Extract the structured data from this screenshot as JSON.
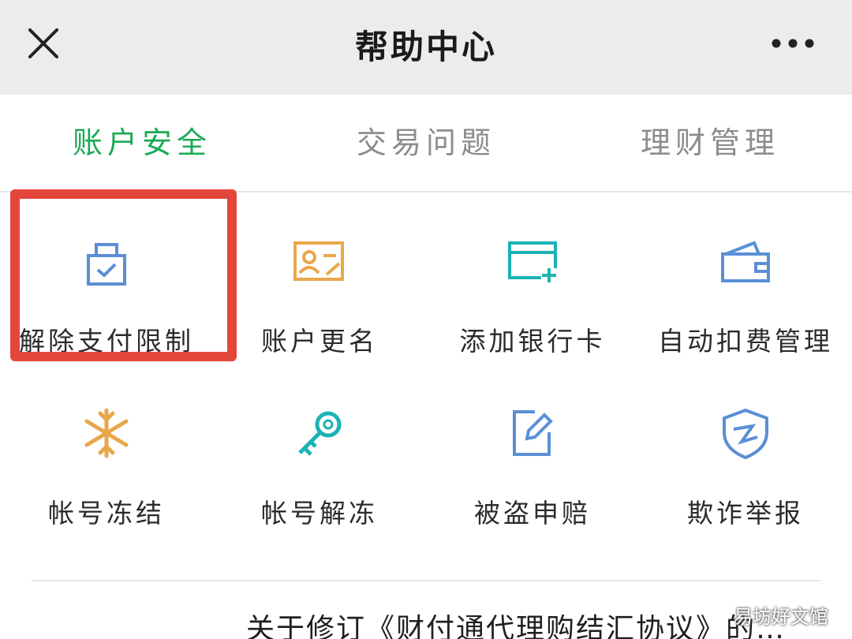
{
  "nav": {
    "title": "帮助中心",
    "close_icon": "close-icon",
    "more_icon": "more-icon"
  },
  "tabs": [
    {
      "label": "账户安全",
      "active": true
    },
    {
      "label": "交易问题",
      "active": false
    },
    {
      "label": "理财管理",
      "active": false
    }
  ],
  "grid": {
    "items": [
      {
        "label": "解除支付限制",
        "icon": "lock-check-icon",
        "color": "#5b8fd6"
      },
      {
        "label": "账户更名",
        "icon": "id-card-icon",
        "color": "#e9a74b"
      },
      {
        "label": "添加银行卡",
        "icon": "add-card-icon",
        "color": "#1bb3b3"
      },
      {
        "label": "自动扣费管理",
        "icon": "wallet-icon",
        "color": "#5b8fd6"
      },
      {
        "label": "帐号冻结",
        "icon": "snowflake-icon",
        "color": "#e9a74b"
      },
      {
        "label": "帐号解冻",
        "icon": "key-icon",
        "color": "#1bb3b3"
      },
      {
        "label": "被盗申赔",
        "icon": "edit-document-icon",
        "color": "#5b8fd6"
      },
      {
        "label": "欺诈举报",
        "icon": "shield-icon",
        "color": "#5b8fd6"
      }
    ]
  },
  "notice": {
    "text": "关于修订《财付通代理购结汇协议》的…"
  },
  "watermark": "易坊好文馆",
  "colors": {
    "active_tab": "#1aaa55",
    "inactive_tab": "#8c8c8c",
    "highlight": "#e5463b"
  }
}
